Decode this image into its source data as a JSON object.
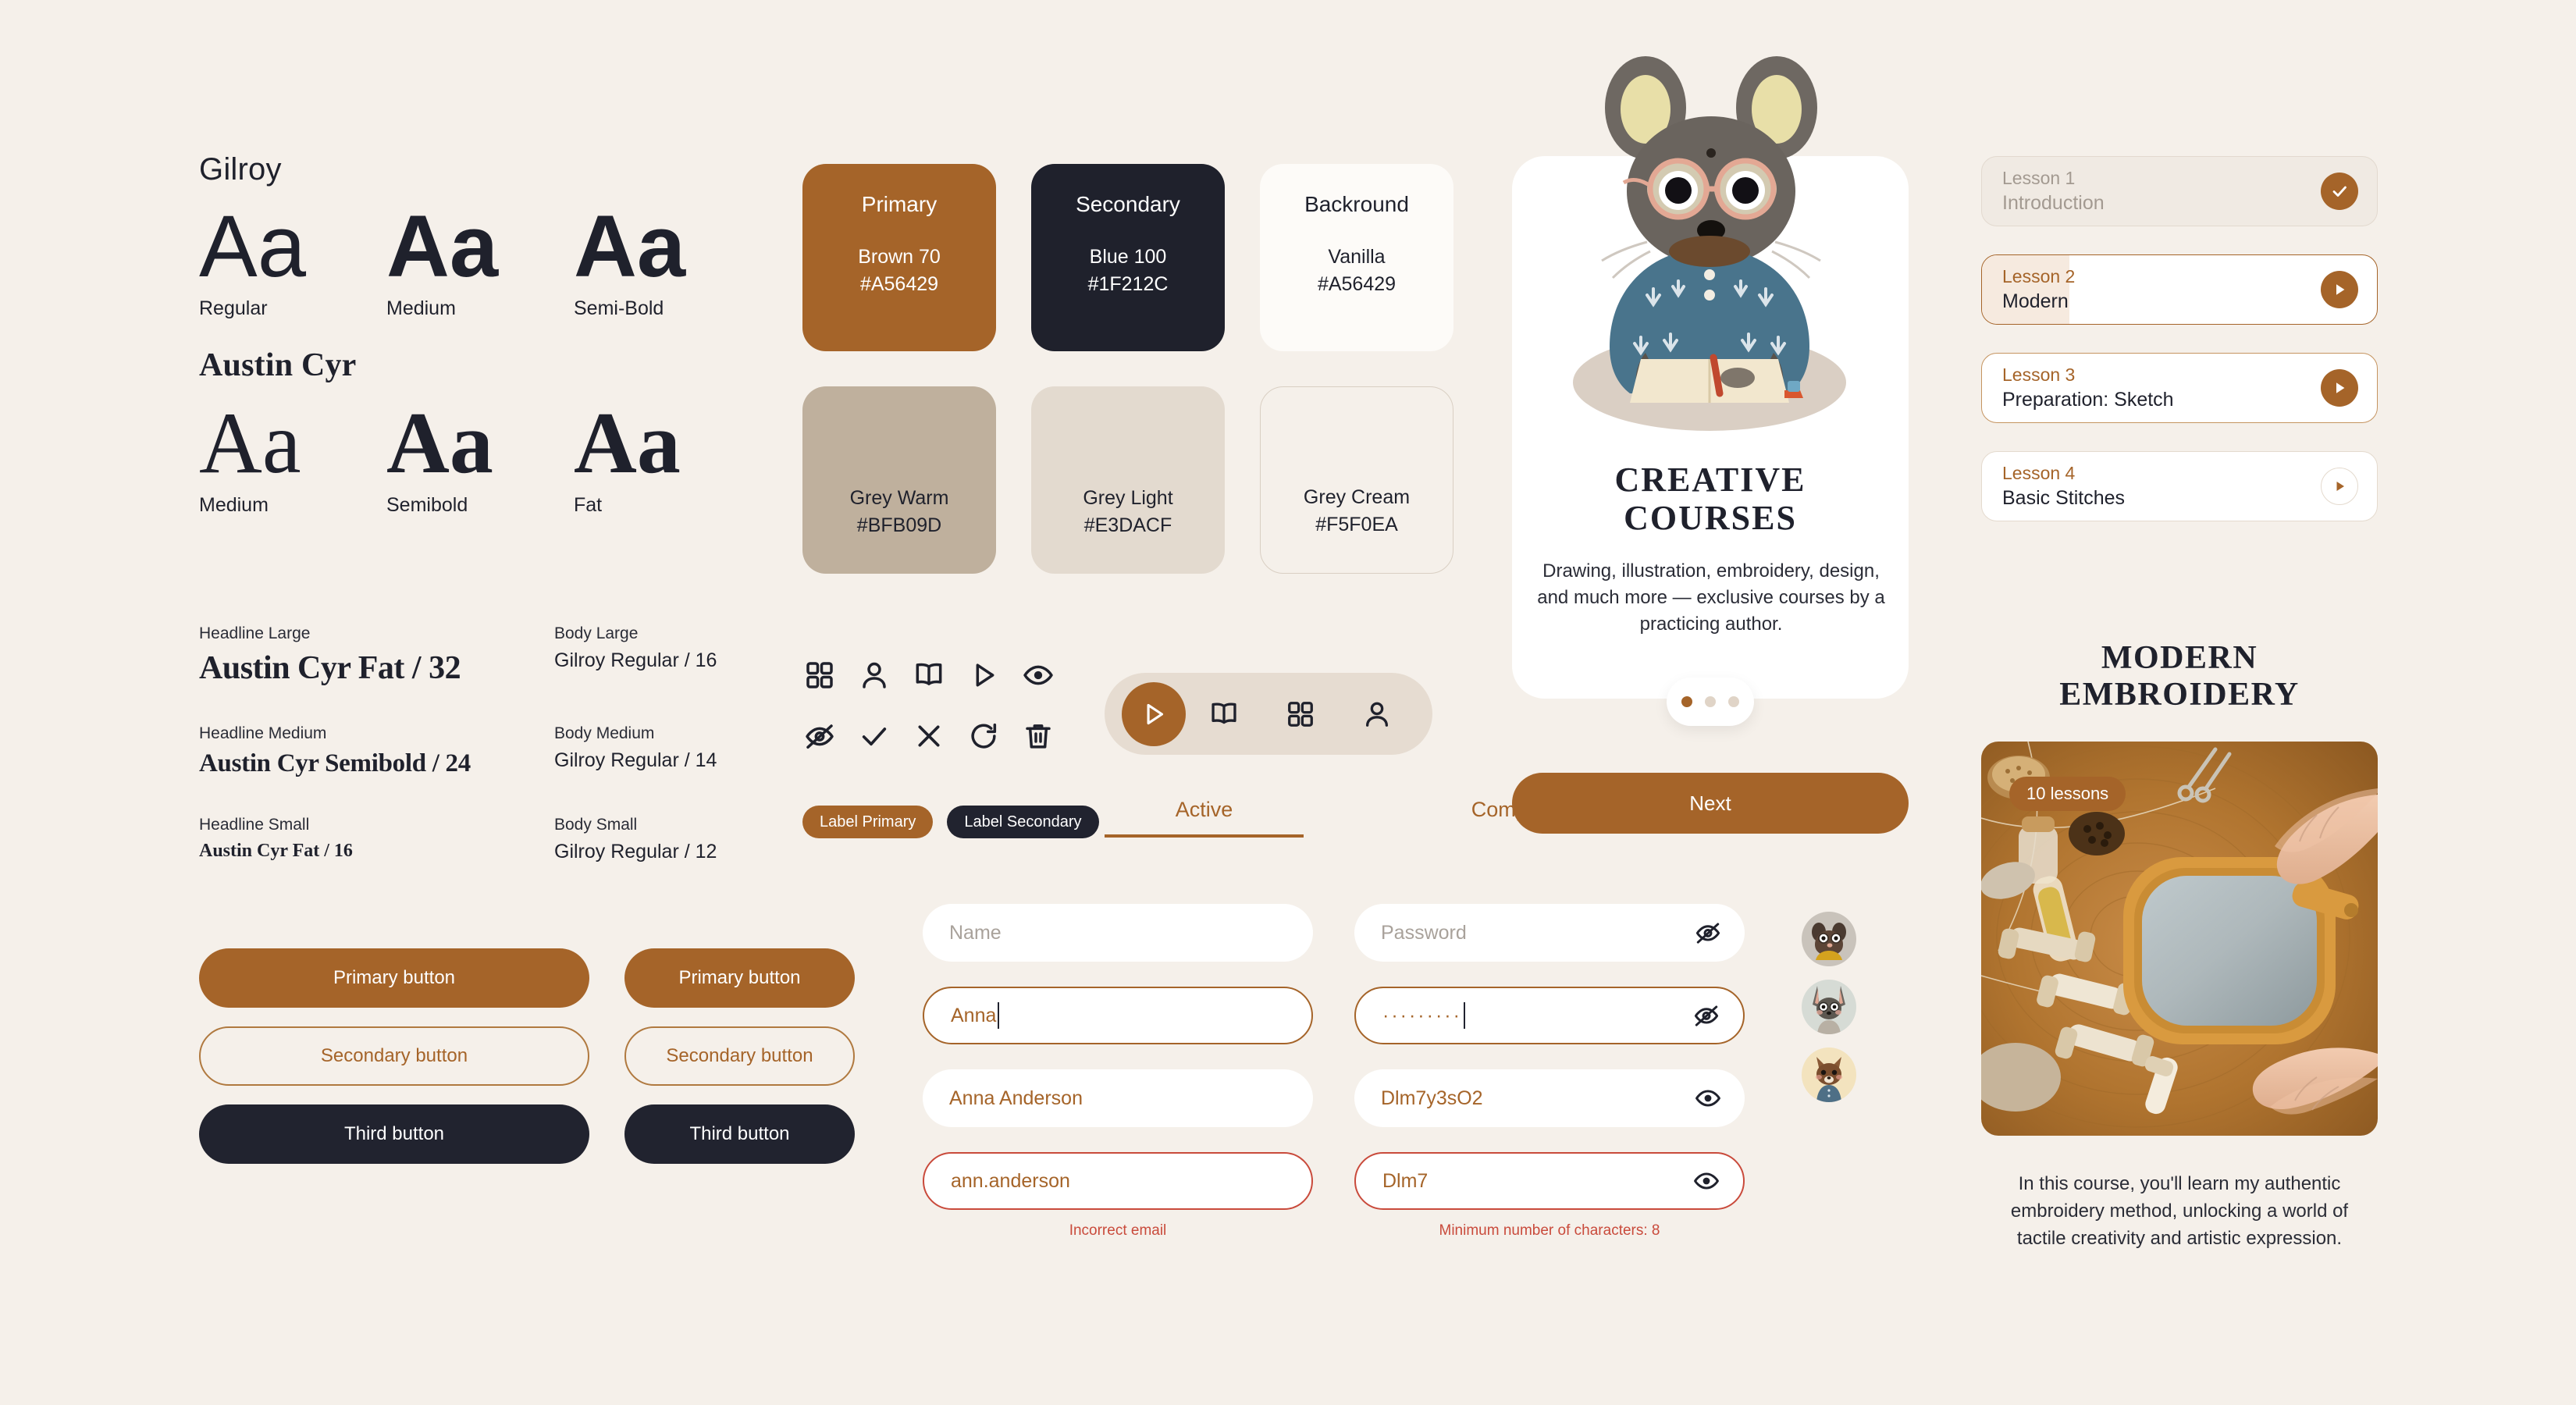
{
  "typography": {
    "families": [
      {
        "name": "Gilroy",
        "serif": false,
        "specimens": [
          {
            "glyph": "Aa",
            "weight": "w400",
            "label": "Regular"
          },
          {
            "glyph": "Aa",
            "weight": "w500",
            "label": "Medium"
          },
          {
            "glyph": "Aa",
            "weight": "w600",
            "label": "Semi-Bold"
          }
        ]
      },
      {
        "name": "Austin Cyr",
        "serif": true,
        "specimens": [
          {
            "glyph": "Aa",
            "weight": "w400",
            "label": "Medium"
          },
          {
            "glyph": "Aa",
            "weight": "w500",
            "label": "Semibold"
          },
          {
            "glyph": "Aa",
            "weight": "w600",
            "label": "Fat"
          }
        ]
      }
    ],
    "scale": [
      {
        "label": "Headline Large",
        "value": "Austin Cyr Fat / 32",
        "size_class": "s32",
        "style": "serif"
      },
      {
        "label": "Body Large",
        "value": "Gilroy Regular / 16",
        "size_class": "",
        "style": "sans"
      },
      {
        "label": "Headline Medium",
        "value": "Austin Cyr Semibold / 24",
        "size_class": "s24",
        "style": "serif"
      },
      {
        "label": "Body Medium",
        "value": "Gilroy Regular / 14",
        "size_class": "",
        "style": "sans"
      },
      {
        "label": "Headline Small",
        "value": "Austin Cyr Fat / 16",
        "size_class": "s16",
        "style": "serif"
      },
      {
        "label": "Body Small",
        "value": "Gilroy Regular / 12",
        "size_class": "",
        "style": "sans"
      }
    ]
  },
  "buttons": {
    "wide": [
      {
        "label": "Primary button",
        "variant": "primary"
      },
      {
        "label": "Secondary button",
        "variant": "secondary"
      },
      {
        "label": "Third button",
        "variant": "third"
      }
    ],
    "narrow": [
      {
        "label": "Primary button",
        "variant": "primary"
      },
      {
        "label": "Secondary button",
        "variant": "secondary"
      },
      {
        "label": "Third button",
        "variant": "third"
      }
    ]
  },
  "colors": [
    {
      "role": "Primary",
      "name": "Brown 70",
      "hex": "#A56429",
      "swatch_class": "sw-brown",
      "position": "top"
    },
    {
      "role": "Secondary",
      "name": "Blue 100",
      "hex": "#1F212C",
      "swatch_class": "sw-blue",
      "position": "top"
    },
    {
      "role": "Backround",
      "name": "Vanilla",
      "hex": "#A56429",
      "swatch_class": "sw-vanilla",
      "position": "top"
    },
    {
      "role": "",
      "name": "Grey Warm",
      "hex": "#BFB09D",
      "swatch_class": "sw-greywarm",
      "position": "bottom"
    },
    {
      "role": "",
      "name": "Grey Light",
      "hex": "#E3DACF",
      "swatch_class": "sw-greylight",
      "position": "bottom"
    },
    {
      "role": "",
      "name": "Grey Cream",
      "hex": "#F5F0EA",
      "swatch_class": "sw-greycream",
      "position": "bottom"
    }
  ],
  "icons": [
    {
      "name": "grid-icon"
    },
    {
      "name": "user-icon"
    },
    {
      "name": "book-open-icon"
    },
    {
      "name": "play-icon"
    },
    {
      "name": "eye-icon"
    },
    {
      "name": "eye-off-icon"
    },
    {
      "name": "check-icon"
    },
    {
      "name": "close-icon"
    },
    {
      "name": "refresh-icon"
    },
    {
      "name": "trash-icon"
    }
  ],
  "segmented_nav": {
    "items": [
      {
        "name": "play-icon",
        "active": true
      },
      {
        "name": "book-open-icon",
        "active": false
      },
      {
        "name": "grid-icon",
        "active": false
      },
      {
        "name": "user-icon",
        "active": false
      }
    ]
  },
  "chips": [
    {
      "label": "Label Primary",
      "variant": "primary"
    },
    {
      "label": "Label Secondary",
      "variant": "secondary"
    }
  ],
  "tabs": [
    {
      "label": "Active",
      "active": true
    },
    {
      "label": "Completed",
      "active": false
    }
  ],
  "form": {
    "left_column": [
      {
        "state": "placeholder",
        "value": "Name",
        "error": ""
      },
      {
        "state": "focused",
        "value": "Anna",
        "error": "",
        "caret": true
      },
      {
        "state": "filled",
        "value": "Anna Anderson",
        "error": ""
      },
      {
        "state": "error",
        "value": "ann.anderson",
        "error": "Incorrect email"
      }
    ],
    "right_column": [
      {
        "state": "placeholder",
        "value": "Password",
        "error": "",
        "icon": "eye-off-icon"
      },
      {
        "state": "focused",
        "value": "·········",
        "error": "",
        "icon": "eye-off-icon",
        "caret": true,
        "masked": true
      },
      {
        "state": "filled",
        "value": "Dlm7y3sO2",
        "error": "",
        "icon": "eye-icon"
      },
      {
        "state": "error",
        "value": "Dlm7",
        "error": "Minimum number of characters: 8",
        "icon": "eye-icon"
      }
    ]
  },
  "avatars": [
    {
      "name": "avatar-dog",
      "bg": "#C9C3BB"
    },
    {
      "name": "avatar-rabbit",
      "bg": "#D6DBD5"
    },
    {
      "name": "avatar-fox",
      "bg": "#F3E3BE"
    }
  ],
  "course_card": {
    "title": "CREATIVE\nCOURSES",
    "title_line1": "CREATIVE",
    "title_line2": "COURSES",
    "description": "Drawing, illustration, embroidery, design, and much more — exclusive courses by a practicing author.",
    "pagination": {
      "total": 3,
      "current": 1
    },
    "next_label": "Next"
  },
  "lessons": [
    {
      "number": "Lesson 1",
      "name": "Introduction",
      "state": "done",
      "action": "check-icon",
      "action_style": "solid"
    },
    {
      "number": "Lesson 2",
      "name": "Modern",
      "state": "current",
      "action": "play-icon",
      "action_style": "solid"
    },
    {
      "number": "Lesson 3",
      "name": "Preparation: Sketch",
      "state": "open",
      "action": "play-icon",
      "action_style": "solid"
    },
    {
      "number": "Lesson 4",
      "name": "Basic Stitches",
      "state": "pending",
      "action": "play-icon",
      "action_style": "ghost"
    }
  ],
  "promo": {
    "title_line1": "MODERN",
    "title_line2": "EMBROIDERY",
    "badge": "10 lessons",
    "description": "In this course, you'll learn my authentic embroidery method, unlocking a world of tactile creativity and artistic expression."
  },
  "palette": {
    "background": "#F5F0EA",
    "primary": "#A56429",
    "secondary": "#1F212C",
    "vanilla": "#FDFBF8",
    "grey_warm": "#BFB09D",
    "grey_light": "#E3DACF",
    "grey_cream": "#F5F0EA",
    "error": "#C94A3B"
  }
}
